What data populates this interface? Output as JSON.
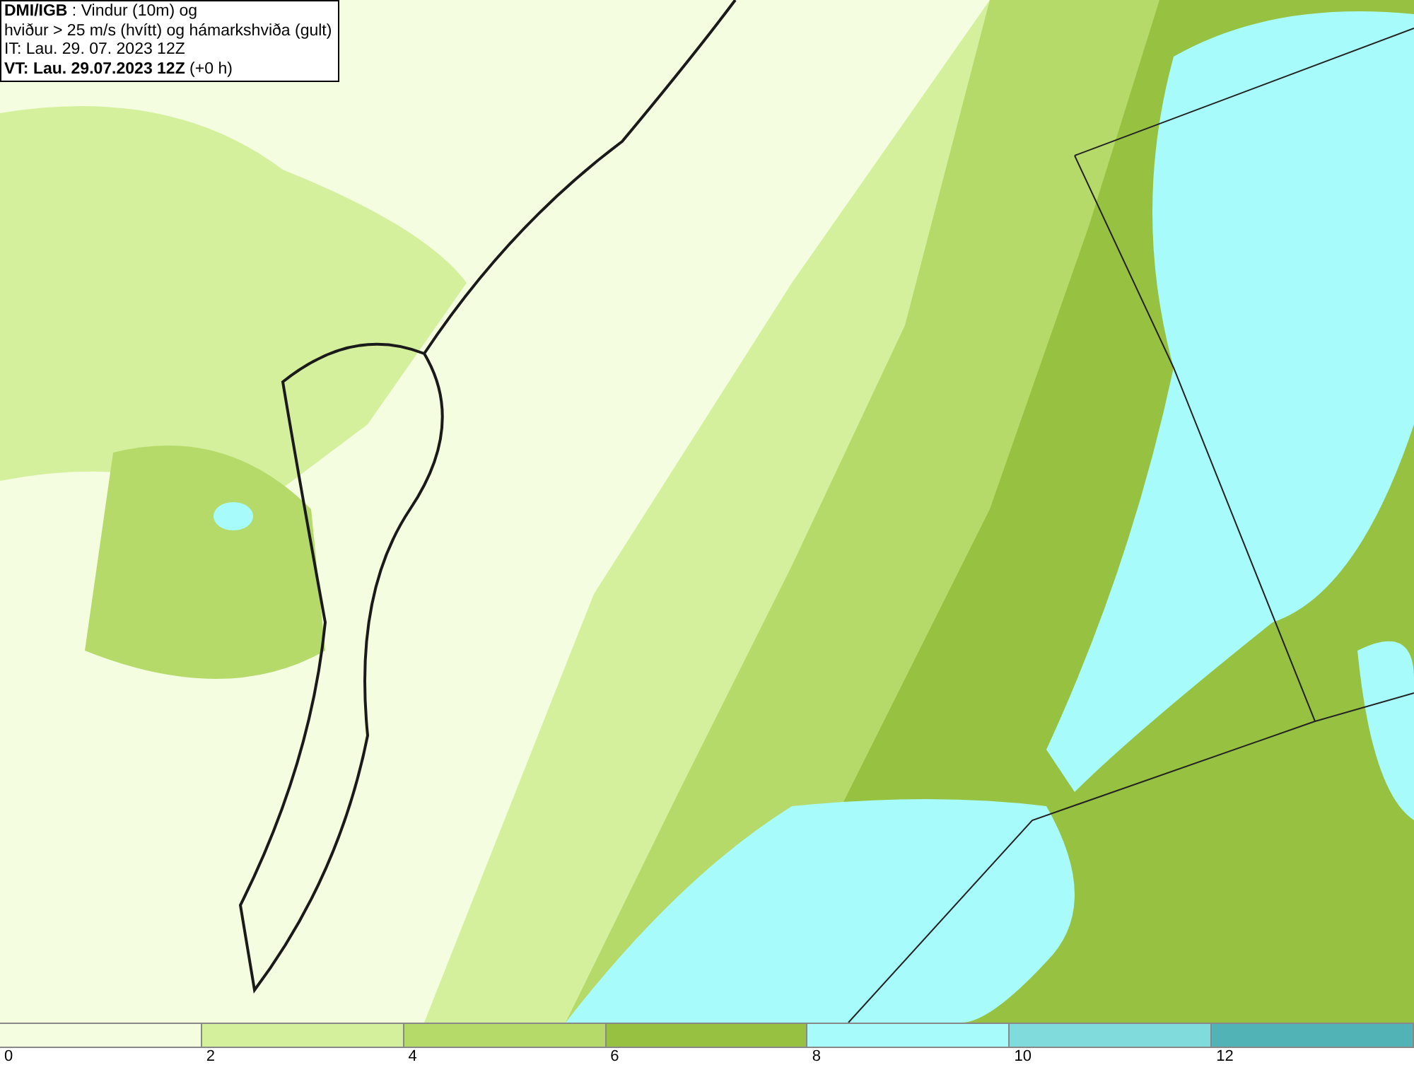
{
  "caption": {
    "lines": [
      "**DMI/IGB** : Vindur (10m) og",
      "hviður > 25 m/s (hvítt) og hámarkshviða (gult)",
      "IT: Lau. 29. 07. 2023 12Z",
      "**VT: Lau. 29.07.2023 12Z** (+0 h)"
    ]
  },
  "legend": {
    "bins": [
      {
        "color": "#f4fde0"
      },
      {
        "color": "#d5f09c"
      },
      {
        "color": "#b5da6a"
      },
      {
        "color": "#97c140"
      },
      {
        "color": "#a8fbfb"
      },
      {
        "color": "#80dcdc"
      },
      {
        "color": "#52b3b6"
      }
    ],
    "labels": [
      "0",
      "2",
      "4",
      "6",
      "8",
      "10",
      "12"
    ]
  }
}
